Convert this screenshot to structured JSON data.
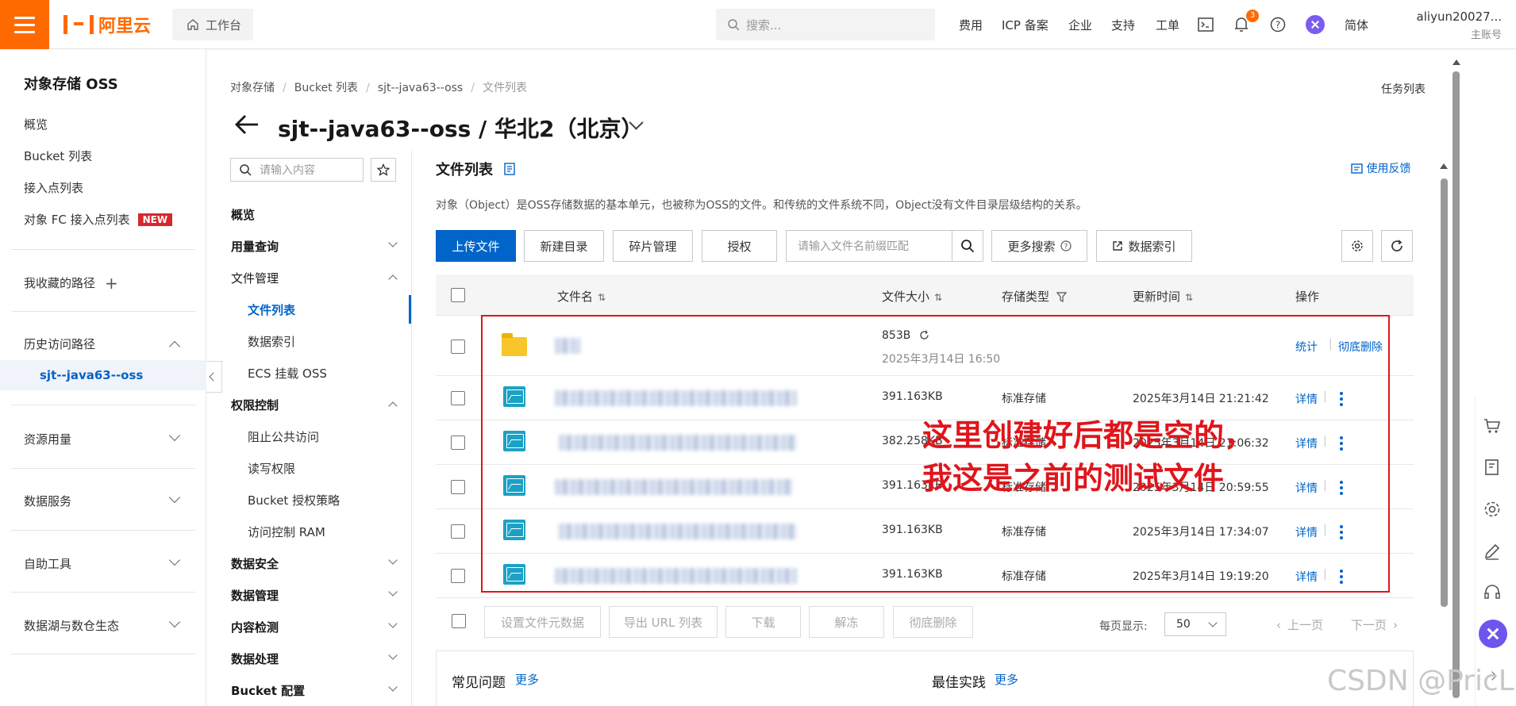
{
  "topbar": {
    "brand": "阿里云",
    "workbench": "工作台",
    "search_placeholder": "搜索...",
    "nav": [
      "费用",
      "ICP 备案",
      "企业",
      "支持",
      "工单"
    ],
    "notification_count": "3",
    "language": "简体",
    "account_name": "aliyun20027...",
    "account_sub": "主账号"
  },
  "sidebar": {
    "title": "对象存储 OSS",
    "items": [
      "概览",
      "Bucket 列表",
      "接入点列表",
      "对象 FC 接入点列表"
    ],
    "new_tag": "NEW",
    "favorites": "我收藏的路径",
    "history": "历史访问路径",
    "history_item": "sjt--java63--oss",
    "groups": [
      "资源用量",
      "数据服务",
      "自助工具",
      "数据湖与数仓生态"
    ]
  },
  "breadcrumb": [
    "对象存储",
    "Bucket 列表",
    "sjt--java63--oss",
    "文件列表"
  ],
  "task_list": "任务列表",
  "page_title": "sjt--java63--oss / 华北2（北京）",
  "subnav": {
    "search_placeholder": "请输入内容",
    "overview": "概览",
    "usage": "用量查询",
    "file_mgmt": "文件管理",
    "file_list": "文件列表",
    "data_index": "数据索引",
    "ecs_mount": "ECS 挂载 OSS",
    "access_ctrl": "权限控制",
    "block_public": "阻止公共访问",
    "rw_perm": "读写权限",
    "bucket_policy": "Bucket 授权策略",
    "ram": "访问控制 RAM",
    "data_security": "数据安全",
    "data_mgmt": "数据管理",
    "content_detect": "内容检测",
    "data_process": "数据处理",
    "bucket_config": "Bucket 配置"
  },
  "main": {
    "title": "文件列表",
    "feedback": "使用反馈",
    "description": "对象（Object）是OSS存储数据的基本单元，也被称为OSS的文件。和传统的文件系统不同，Object没有文件目录层级结构的关系。",
    "toolbar": {
      "upload": "上传文件",
      "new_dir": "新建目录",
      "fragments": "碎片管理",
      "authorize": "授权",
      "filter_placeholder": "请输入文件名前缀匹配",
      "more_search": "更多搜索",
      "data_index": "数据索引"
    },
    "columns": {
      "name": "文件名",
      "size": "文件大小",
      "storage": "存储类型",
      "updated": "更新时间",
      "ops": "操作"
    },
    "folder_row": {
      "size": "853B",
      "time": "2025年3月14日 16:50",
      "stat": "统计",
      "delete": "彻底删除"
    },
    "rows": [
      {
        "size": "391.163KB",
        "storage": "标准存储",
        "time": "2025年3月14日 21:21:42",
        "op": "详情"
      },
      {
        "size": "382.258KB",
        "storage": "标准存储",
        "time": "2025年3月14日 21:06:32",
        "op": "详情"
      },
      {
        "size": "391.163KB",
        "storage": "标准存储",
        "time": "2025年3月14日 20:59:55",
        "op": "详情"
      },
      {
        "size": "391.163KB",
        "storage": "标准存储",
        "time": "2025年3月14日 17:34:07",
        "op": "详情"
      },
      {
        "size": "391.163KB",
        "storage": "标准存储",
        "time": "2025年3月14日 19:19:20",
        "op": "详情"
      }
    ],
    "annotation": [
      "这里创建好后都是空的，",
      "我这是之前的测试文件"
    ],
    "batch": [
      "设置文件元数据",
      "导出 URL 列表",
      "下载",
      "解冻",
      "彻底删除"
    ],
    "per_page_label": "每页显示:",
    "per_page_value": "50",
    "prev": "上一页",
    "next": "下一页",
    "faq": "常见问题",
    "faq_more": "更多",
    "best": "最佳实践",
    "best_more": "更多"
  },
  "watermark": "CSDN @PricLil",
  "colors": {
    "brand": "#ff6a00",
    "primary": "#0064c8",
    "annotation": "#e0151b"
  }
}
